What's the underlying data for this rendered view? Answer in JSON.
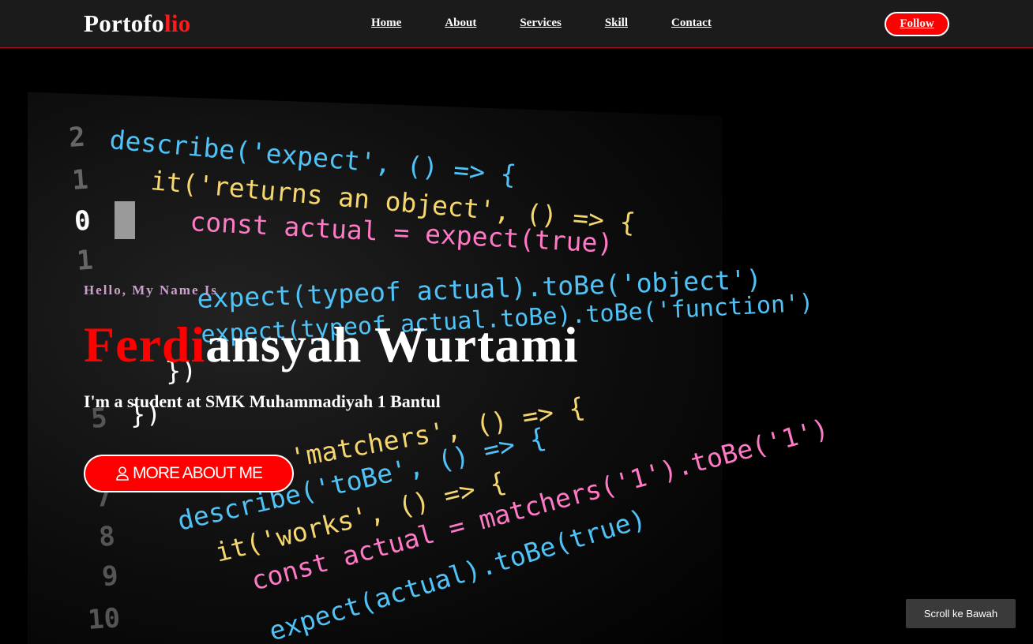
{
  "navbar": {
    "logo_main": "Portofo",
    "logo_accent": "lio",
    "links": [
      "Home",
      "About",
      "Services",
      "Skill",
      "Contact"
    ],
    "follow_label": "Follow"
  },
  "hero": {
    "greeting": "Hello, My Name Is",
    "name_accent": "Ferdi",
    "name_rest": "ansyah Wurtami",
    "tagline": "I'm a student at SMK Muhammadiyah 1 Bantul",
    "button_label": "MORE ABOUT ME",
    "button_icon": "user-icon"
  },
  "background_code": {
    "line_numbers": [
      "2",
      "1",
      "0",
      "1",
      "5",
      "7",
      "8",
      "9",
      "10"
    ],
    "lines": [
      "describe('expect', () => {",
      "it('returns an object', () => {",
      "const actual = expect(true)",
      "expect(typeof actual).toBe('object')",
      "expect(typeof actual.toBe).toBe('function')",
      "})",
      "})",
      "'matchers', () => {",
      "describe('toBe', () => {",
      "it('works', () => {",
      "const actual = matchers('1').toBe('1')",
      "expect(actual).toBe(true)"
    ]
  },
  "scroll_button": {
    "label": "Scroll ke Bawah"
  },
  "colors": {
    "accent": "#ff0000",
    "navbar_bg": "#1b1b1b",
    "navbar_border": "#b3101d"
  }
}
